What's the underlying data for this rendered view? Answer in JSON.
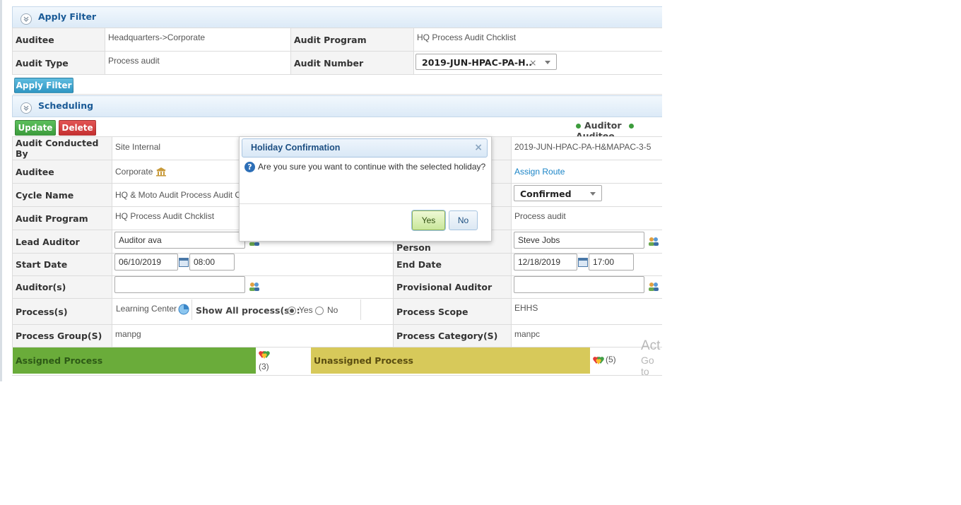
{
  "apply_filter": {
    "title": "Apply Filter",
    "auditee_label": "Auditee",
    "auditee_value": "Headquarters->Corporate",
    "audit_program_label": "Audit Program",
    "audit_program_value": "HQ Process Audit Chcklist",
    "audit_type_label": "Audit Type",
    "audit_type_value": "Process audit",
    "audit_number_label": "Audit Number",
    "audit_number_value": "2019-JUN-HPAC-PA-H..",
    "apply_button": "Apply Filter"
  },
  "scheduling": {
    "title": "Scheduling",
    "update_button": "Update",
    "delete_button": "Delete",
    "legend": [
      "Auditor",
      "Auditee"
    ],
    "audit_conducted_by_label": "Audit Conducted By",
    "audit_conducted_by_value": "Site Internal",
    "audit_id_value": "2019-JUN-HPAC-PA-H&MAPAC-3-5",
    "auditee_label": "Auditee",
    "auditee_value": "Corporate",
    "assign_route": "Assign Route",
    "cycle_name_label": "Cycle Name",
    "cycle_name_value": "HQ & Moto Audit Process Audit C",
    "status_value": "Confirmed",
    "audit_program_label": "Audit Program",
    "audit_program_value": "HQ Process Audit Chcklist",
    "audit_type_value": "Process audit",
    "lead_auditor_label": "Lead Auditor",
    "lead_auditor_value": "Auditor  ava",
    "auditee_contact_label": "Auditee Contact Person",
    "auditee_contact_value": "Steve Jobs",
    "start_date_label": "Start Date",
    "start_date_value": "06/10/2019",
    "start_time_value": "08:00",
    "end_date_label": "End Date",
    "end_date_value": "12/18/2019",
    "end_time_value": "17:00",
    "auditors_label": "Auditor(s)",
    "provisional_auditor_label": "Provisional Auditor",
    "processes_label": "Process(s)",
    "processes_value": "Learning Center",
    "show_all_label": "Show All process(s) :",
    "yes_label": "Yes",
    "no_label": "No",
    "process_scope_label": "Process Scope",
    "process_scope_value": "EHHS",
    "process_group_label": "Process Group(S)",
    "process_group_value": "manpg",
    "process_category_label": "Process Category(S)",
    "process_category_value": "manpc",
    "assigned_label": "Assigned Process",
    "assigned_count": "(3)",
    "unassigned_label": "Unassigned Process",
    "unassigned_count": "(5)"
  },
  "dialog": {
    "title": "Holiday Confirmation",
    "message": "Are you sure you want to continue with the selected holiday?",
    "yes": "Yes",
    "no": "No",
    "close_glyph": "×"
  },
  "watermark": {
    "line1": "Act",
    "line2": "Go to"
  },
  "colors": {
    "assigned_bar": "#6aac3a",
    "unassigned_bar": "#d7c95a",
    "header_text": "#1a5a96"
  }
}
